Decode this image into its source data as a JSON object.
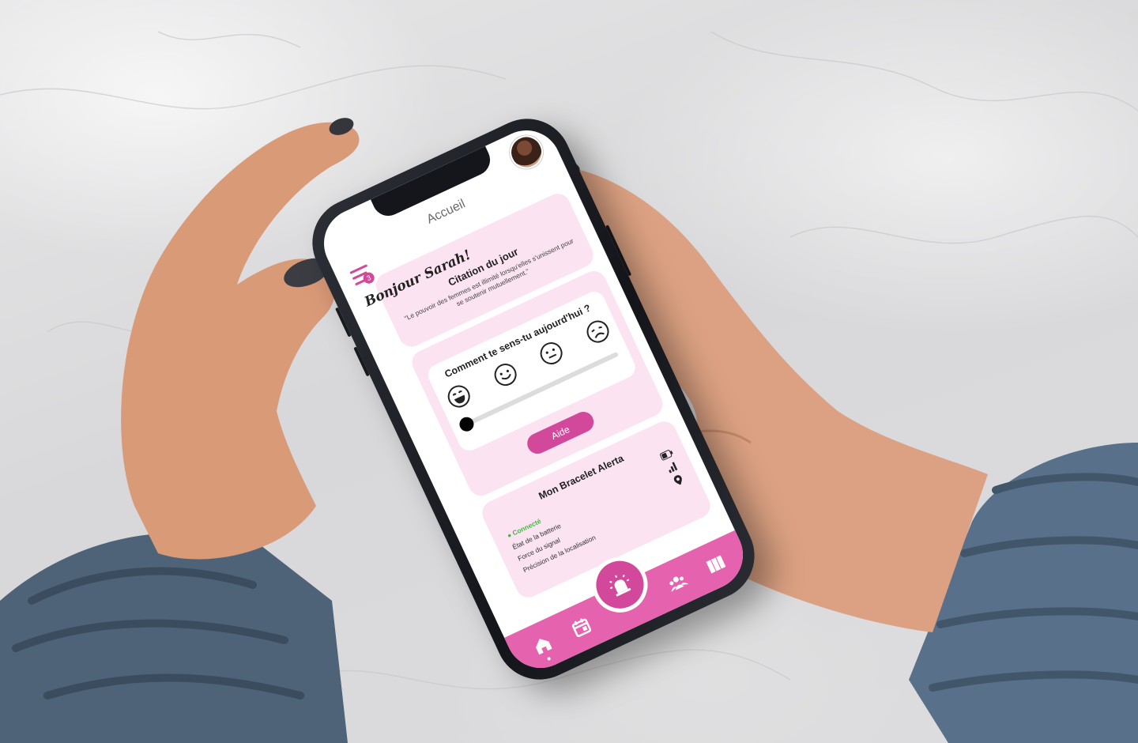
{
  "app": {
    "nav_title": "Accueil",
    "menu_badge": "3",
    "greeting": "Bonjour Sarah!"
  },
  "quote": {
    "title": "Citation du jour",
    "text": "\"Le pouvoir des femmes est illimité lorsqu'elles s'unissent pour se soutenir mutuellement.\""
  },
  "mood": {
    "question": "Comment te sens-tu aujourd'hui ?",
    "faces": [
      "laughing-face-icon",
      "smile-face-icon",
      "neutral-face-icon",
      "sad-face-icon"
    ],
    "slider_level": 0.0,
    "help_button": "Aide"
  },
  "bracelet": {
    "title": "Mon Bracelet Alerta",
    "status": "Connecté",
    "battery_label": "État de la batterie",
    "signal_label": "Force du signal",
    "location_label": "Précision de la localisation"
  },
  "tabbar": {
    "items": [
      "home-icon",
      "calendar-icon",
      "alarm-light-icon",
      "users-icon",
      "book-icon"
    ],
    "active": "home-icon"
  },
  "colors": {
    "accent": "#d2499b",
    "tabbar": "#e563ae",
    "card": "#fbe3f1",
    "connected": "#3dbb3d"
  }
}
